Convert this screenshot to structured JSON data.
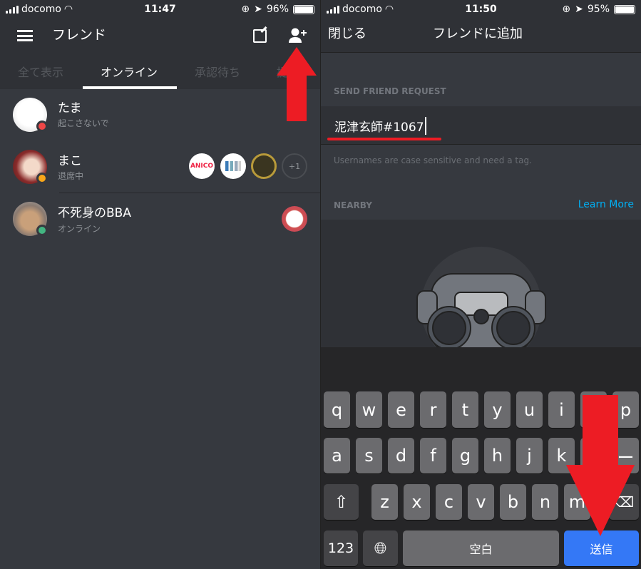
{
  "left": {
    "status": {
      "carrier": "docomo",
      "time": "11:47",
      "battery": "96%"
    },
    "header": {
      "title": "フレンド",
      "menu_icon": "hamburger-icon",
      "compose_icon": "compose-icon",
      "add_friend_icon": "add-friend-icon"
    },
    "tabs": [
      {
        "label": "全て表示"
      },
      {
        "label": "オンライン",
        "active": true
      },
      {
        "label": "承認待ち"
      },
      {
        "label": "提"
      }
    ],
    "friends": [
      {
        "name": "たま",
        "status": "起こさないで",
        "status_color": "#f04747"
      },
      {
        "name": "まこ",
        "status": "退席中",
        "status_color": "#faa61a",
        "games": [
          "ANICO",
          "",
          "",
          ""
        ],
        "more": "+1"
      },
      {
        "name": "不死身のBBA",
        "status": "オンライン",
        "status_color": "#43b581"
      }
    ]
  },
  "right": {
    "status": {
      "carrier": "docomo",
      "time": "11:50",
      "battery": "95%"
    },
    "header": {
      "close": "閉じる",
      "title": "フレンドに追加"
    },
    "send_label": "SEND FRIEND REQUEST",
    "input_value": "泥津玄師#1067",
    "hint": "Usernames are case sensitive and need a tag.",
    "nearby_label": "NEARBY",
    "learn_more": "Learn More",
    "keyboard": {
      "row1": [
        "q",
        "w",
        "e",
        "r",
        "t",
        "y",
        "u",
        "i",
        "o",
        "p"
      ],
      "row2": [
        "a",
        "s",
        "d",
        "f",
        "g",
        "h",
        "j",
        "k",
        "l",
        "ー"
      ],
      "row3": [
        "z",
        "x",
        "c",
        "v",
        "b",
        "n",
        "m"
      ],
      "num": "123",
      "space": "空白",
      "send": "送信"
    }
  },
  "colors": {
    "accent_blue": "#00b0f4",
    "send_blue": "#3478f6",
    "annotation_red": "#ed1c24"
  }
}
